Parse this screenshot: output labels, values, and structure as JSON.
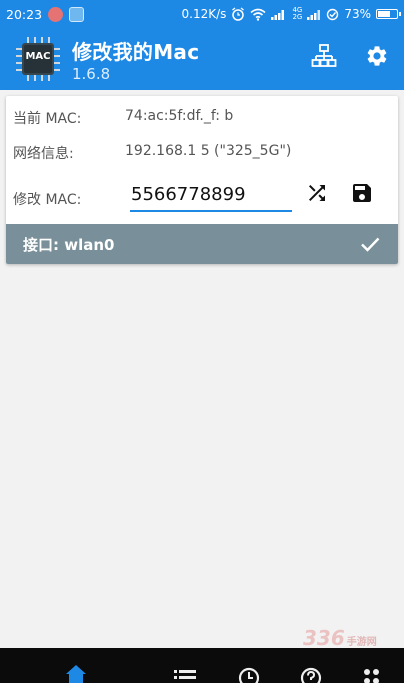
{
  "status_bar": {
    "time": "20:23",
    "speed": "0.12K/s",
    "network_type_top": "4G",
    "network_type_bottom": "2G",
    "battery": "73%",
    "battery_level": 0.73
  },
  "app_bar": {
    "logo_text": "MAC",
    "title": "修改我的Mac",
    "version": "1.6.8"
  },
  "card": {
    "current_mac_label": "当前 MAC:",
    "current_mac_value": "74:ac:5f:df._f:  b",
    "network_label": "网络信息:",
    "network_value": "192.168.1 5 (\"325_5G\")",
    "edit_mac_label": "修改 MAC:",
    "edit_mac_value": "5566778899",
    "interface_label": "接口: wlan0"
  },
  "watermark": {
    "text": "336",
    "subtext": "手游网"
  },
  "colors": {
    "primary": "#1e88e5",
    "interface_bar": "#79909a",
    "background": "#f2f2f2"
  },
  "icons": {
    "network": "network-icon",
    "settings": "gear-icon",
    "shuffle": "shuffle-icon",
    "save": "save-icon",
    "check": "check-icon"
  }
}
